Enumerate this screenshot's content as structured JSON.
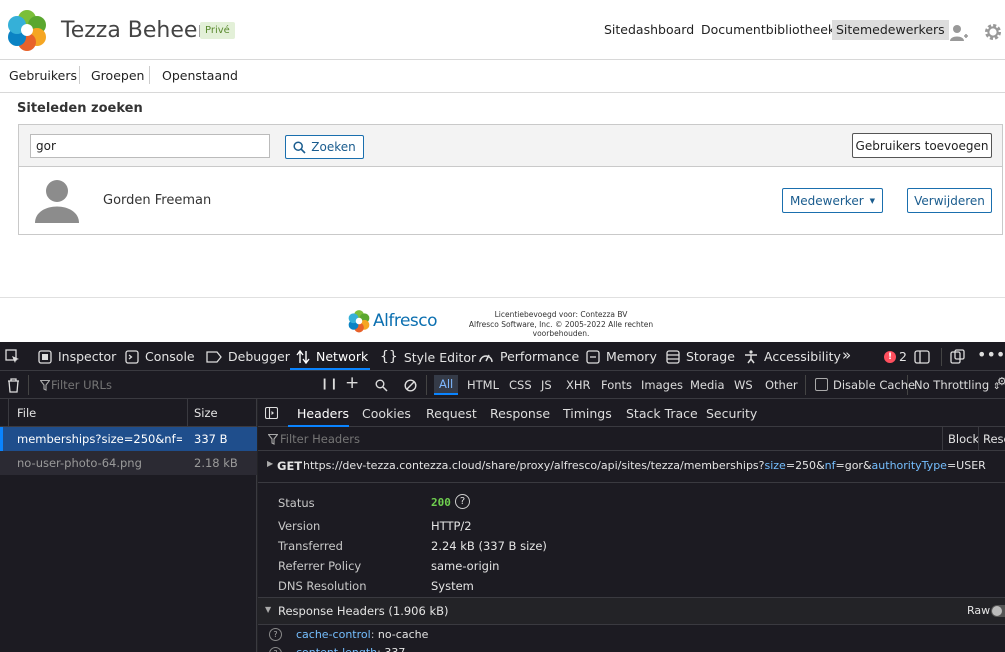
{
  "site": {
    "title": "Tezza Beheer",
    "visibility_badge": "Privé",
    "nav": [
      "Sitedashboard",
      "Documentbibliotheek",
      "Sitemedewerkers"
    ],
    "active_nav": "Sitemedewerkers"
  },
  "subnav": [
    "Gebruikers",
    "Groepen",
    "Openstaand"
  ],
  "search": {
    "section_title": "Siteleden zoeken",
    "input_value": "gor",
    "search_button": "Zoeken",
    "add_users_button": "Gebruikers toevoegen"
  },
  "member": {
    "name": "Gorden Freeman",
    "role_button": "Medewerker",
    "remove_button": "Verwijderen"
  },
  "footer": {
    "logo_text": "Alfresco",
    "license_line1": "Licentiebevoegd voor: Contezza BV",
    "license_line2": "Alfresco Software, Inc. © 2005-2022 Alle rechten",
    "license_line3": "voorbehouden."
  },
  "devtools": {
    "tabs": [
      "Inspector",
      "Console",
      "Debugger",
      "Network",
      "Style Editor",
      "Performance",
      "Memory",
      "Storage",
      "Accessibility"
    ],
    "active_tab": "Network",
    "error_count": "2",
    "filter_placeholder": "Filter URLs",
    "type_filters": [
      "All",
      "HTML",
      "CSS",
      "JS",
      "XHR",
      "Fonts",
      "Images",
      "Media",
      "WS",
      "Other"
    ],
    "disable_cache_label": "Disable Cache",
    "throttling_label": "No Throttling",
    "columns": {
      "file": "File",
      "size": "Size"
    },
    "requests": [
      {
        "file": "memberships?size=250&nf=gor",
        "size": "337 B",
        "selected": true
      },
      {
        "file": "no-user-photo-64.png",
        "size": "2.18 kB",
        "selected": false
      }
    ],
    "detail_tabs": [
      "Headers",
      "Cookies",
      "Request",
      "Response",
      "Timings",
      "Stack Trace",
      "Security"
    ],
    "active_detail_tab": "Headers",
    "filter_headers_placeholder": "Filter Headers",
    "block_label": "Block",
    "resend_label": "Rese",
    "request_method": "GET",
    "request_url_base": "https://dev-tezza.contezza.cloud/share/proxy/alfresco/api/sites/tezza/memberships?",
    "request_url_params": [
      {
        "key": "size",
        "value": "250"
      },
      {
        "key": "nf",
        "value": "gor"
      },
      {
        "key": "authorityType",
        "value": "USER"
      }
    ],
    "summary": [
      {
        "key": "Status",
        "value": "200"
      },
      {
        "key": "Version",
        "value": "HTTP/2"
      },
      {
        "key": "Transferred",
        "value": "2.24 kB (337 B size)"
      },
      {
        "key": "Referrer Policy",
        "value": "same-origin"
      },
      {
        "key": "DNS Resolution",
        "value": "System"
      }
    ],
    "response_headers_title": "Response Headers (1.906 kB)",
    "raw_label": "Raw",
    "response_headers": [
      {
        "name": "cache-control",
        "value": "no-cache"
      },
      {
        "name": "content-length",
        "value": "337"
      }
    ]
  },
  "colors": {
    "alfresco_blue": "#1a6fae",
    "devtools_bg": "#1c1b22",
    "accent": "#0a84ff",
    "selected_row": "#1f4e8c",
    "status_ok": "#6fcf4f"
  }
}
